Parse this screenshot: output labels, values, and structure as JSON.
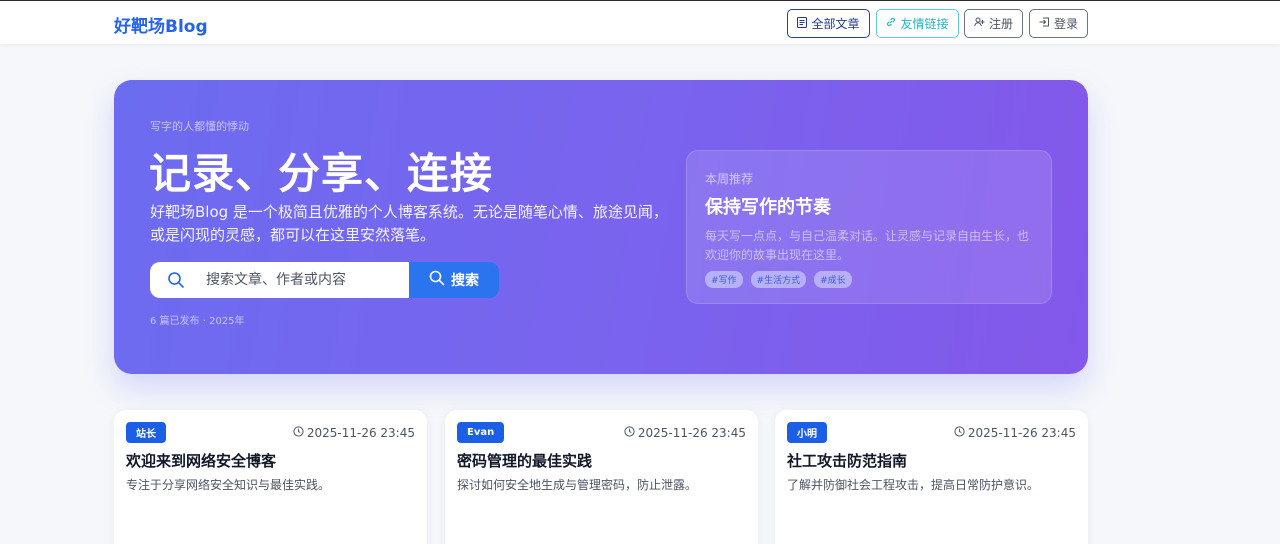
{
  "nav": {
    "brand": "好靶场Blog",
    "buttons": {
      "all_posts": "全部文章",
      "friend_links": "友情链接",
      "register": "注册",
      "login": "登录"
    }
  },
  "hero": {
    "eyebrow": "写字的人都懂的悸动",
    "title": "记录、分享、连接",
    "description": "好靶场Blog 是一个极简且优雅的个人博客系统。无论是随笔心情、旅途见闻，或是闪现的灵感，都可以在这里安然落笔。",
    "search": {
      "placeholder": "搜索文章、作者或内容",
      "button_label": "搜索"
    },
    "meta": "6 篇已发布 · 2025年",
    "recommend": {
      "label": "本周推荐",
      "title": "保持写作的节奏",
      "description": "每天写一点点，与自己温柔对话。让灵感与记录自由生长，也欢迎你的故事出现在这里。",
      "tags": [
        "#写作",
        "#生活方式",
        "#成长"
      ]
    }
  },
  "posts": [
    {
      "author": "站长",
      "date": "2025-11-26 23:45",
      "title": "欢迎来到网络安全博客",
      "summary": "专注于分享网络安全知识与最佳实践。"
    },
    {
      "author": "Evan",
      "date": "2025-11-26 23:45",
      "title": "密码管理的最佳实践",
      "summary": "探讨如何安全地生成与管理密码，防止泄露。"
    },
    {
      "author": "小明",
      "date": "2025-11-26 23:45",
      "title": "社工攻击防范指南",
      "summary": "了解并防御社会工程攻击，提高日常防护意识。"
    }
  ],
  "colors": {
    "brand": "#2563eb",
    "hero_gradient_start": "#6c6cf0",
    "hero_gradient_end": "#8358ea",
    "search_button": "#2b74f0",
    "author_badge": "#1a5fe6"
  },
  "icons": {
    "all_posts": "document-icon",
    "friend_links": "link-icon",
    "register": "user-plus-icon",
    "login": "login-icon",
    "search": "search-icon",
    "date": "clock-icon"
  }
}
